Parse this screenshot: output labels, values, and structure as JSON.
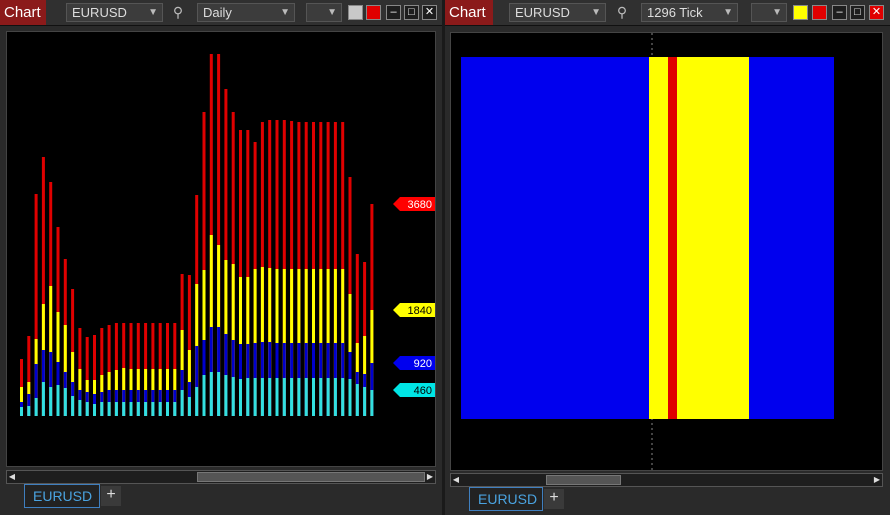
{
  "left_window": {
    "title": "Chart",
    "symbol": "EURUSD",
    "timeframe": "Daily",
    "tab_label": "EURUSD",
    "add_tab": "+",
    "minimize": "–",
    "maximize": "□",
    "close": "✕",
    "level_labels": [
      {
        "text": "3680",
        "color": "#ff0000",
        "text_color": "#ffffff"
      },
      {
        "text": "1840",
        "color": "#ffff00",
        "text_color": "#000000"
      },
      {
        "text": "920",
        "color": "#0000ee",
        "text_color": "#ffffff"
      },
      {
        "text": "460",
        "color": "#00e5e5",
        "text_color": "#000000"
      }
    ]
  },
  "right_window": {
    "title": "Chart",
    "symbol": "EURUSD",
    "timeframe": "1296 Tick",
    "tab_label": "EURUSD",
    "add_tab": "+",
    "minimize": "–",
    "maximize": "□",
    "close": "✕"
  },
  "colors": {
    "red": "#e00000",
    "yellow": "#ffff00",
    "blue": "#0000cc",
    "cyan": "#33e0e0",
    "title_bg": "#8b1a1a",
    "tab_accent": "#4aa3e0"
  }
}
